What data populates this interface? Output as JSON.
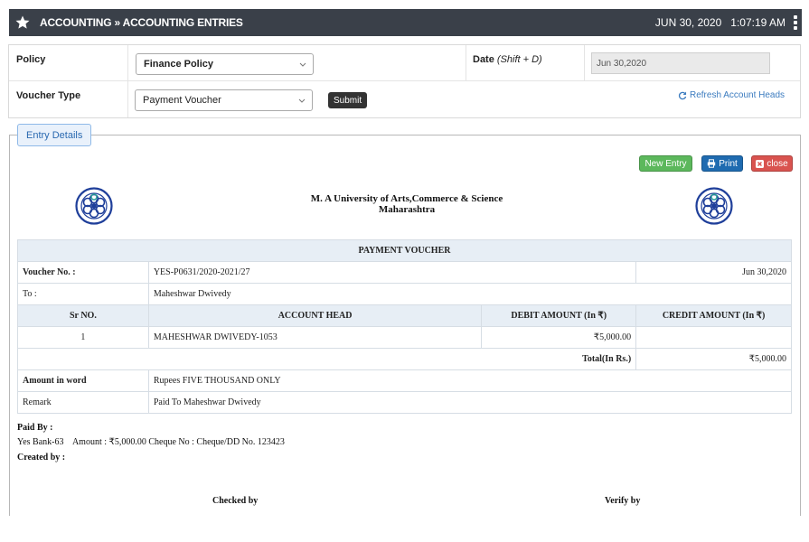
{
  "header": {
    "title": "ACCOUNTING » ACCOUNTING ENTRIES",
    "datetime": "JUN 30, 2020   1:07:19 AM"
  },
  "form": {
    "policy_label": "Policy",
    "policy_value": "Finance Policy",
    "date_label": "Date",
    "date_hint": "(Shift + D)",
    "date_value": "Jun 30,2020",
    "voucher_type_label": "Voucher Type",
    "voucher_type_value": "Payment Voucher",
    "submit_label": "Submit",
    "refresh_label": "Refresh Account Heads"
  },
  "entry": {
    "tab_label": "Entry Details",
    "new_entry_label": "New Entry",
    "print_label": "Print",
    "close_label": "close"
  },
  "voucher": {
    "university": "M. A University of Arts,Commerce & Science",
    "state": "Maharashtra",
    "heading": "PAYMENT VOUCHER",
    "voucher_no_label": "Voucher No. :",
    "voucher_no": "YES-P0631/2020-2021/27",
    "date": "Jun 30,2020",
    "to_label": "To :",
    "to_value": "Maheshwar Dwivedy",
    "columns": [
      "Sr NO.",
      "ACCOUNT HEAD",
      "DEBIT AMOUNT (In ₹)",
      "CREDIT AMOUNT (In ₹)"
    ],
    "rows": [
      {
        "sr": "1",
        "head": "MAHESHWAR DWIVEDY-1053",
        "debit": "₹5,000.00",
        "credit": ""
      }
    ],
    "total_label": "Total(In Rs.)",
    "total_credit": "₹5,000.00",
    "amount_word_label": "Amount in word",
    "amount_word": "Rupees FIVE THOUSAND ONLY",
    "remark_label": "Remark",
    "remark": "Paid To Maheshwar Dwivedy"
  },
  "footer": {
    "paid_by_label": "Paid By :",
    "paid_by_detail": "Yes Bank-63    Amount : ₹5,000.00 Cheque No : Cheque/DD No. 123423",
    "created_by_label": "Created by :",
    "checked_by": "Checked by",
    "verify_by": "Verify by"
  },
  "colors": {
    "titlebar": "#3a4049",
    "new_entry": "#5cb85c",
    "print": "#1f6bb0",
    "close": "#d9534f",
    "link": "#3b7bbf"
  },
  "icons": [
    "star-icon",
    "kebab-menu-icon",
    "chevron-down-icon",
    "refresh-icon",
    "printer-icon",
    "close-x-icon",
    "university-logo"
  ]
}
